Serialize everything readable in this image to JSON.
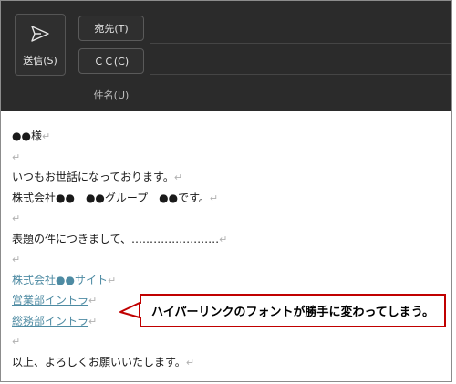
{
  "header": {
    "send_label": "送信(S)",
    "to_label": "宛先(T)",
    "cc_label": "ＣＣ(C)",
    "subject_label": "件名(U)"
  },
  "body": {
    "lines": [
      {
        "text": "●●様",
        "link": false
      },
      {
        "text": "",
        "link": false
      },
      {
        "text": "いつもお世話になっております。",
        "link": false
      },
      {
        "text": "株式会社●●　●●グループ　●●です。",
        "link": false
      },
      {
        "text": "",
        "link": false
      },
      {
        "text": "表題の件につきまして、‥‥‥‥‥‥‥‥‥‥‥‥",
        "link": false
      },
      {
        "text": "",
        "link": false
      },
      {
        "text": "株式会社●●サイト",
        "link": true
      },
      {
        "text": "営業部イントラ",
        "link": true
      },
      {
        "text": "総務部イントラ",
        "link": true
      },
      {
        "text": "",
        "link": false
      },
      {
        "text": "以上、よろしくお願いいたします。",
        "link": false
      }
    ],
    "pilcrow": "↵"
  },
  "callout": {
    "text": "ハイパーリンクのフォントが勝手に変わってしまう。"
  },
  "colors": {
    "link": "#4e8ba3",
    "callout_border": "#c00000",
    "header_bg": "#2b2b2b"
  },
  "icons": [
    "send-icon"
  ]
}
